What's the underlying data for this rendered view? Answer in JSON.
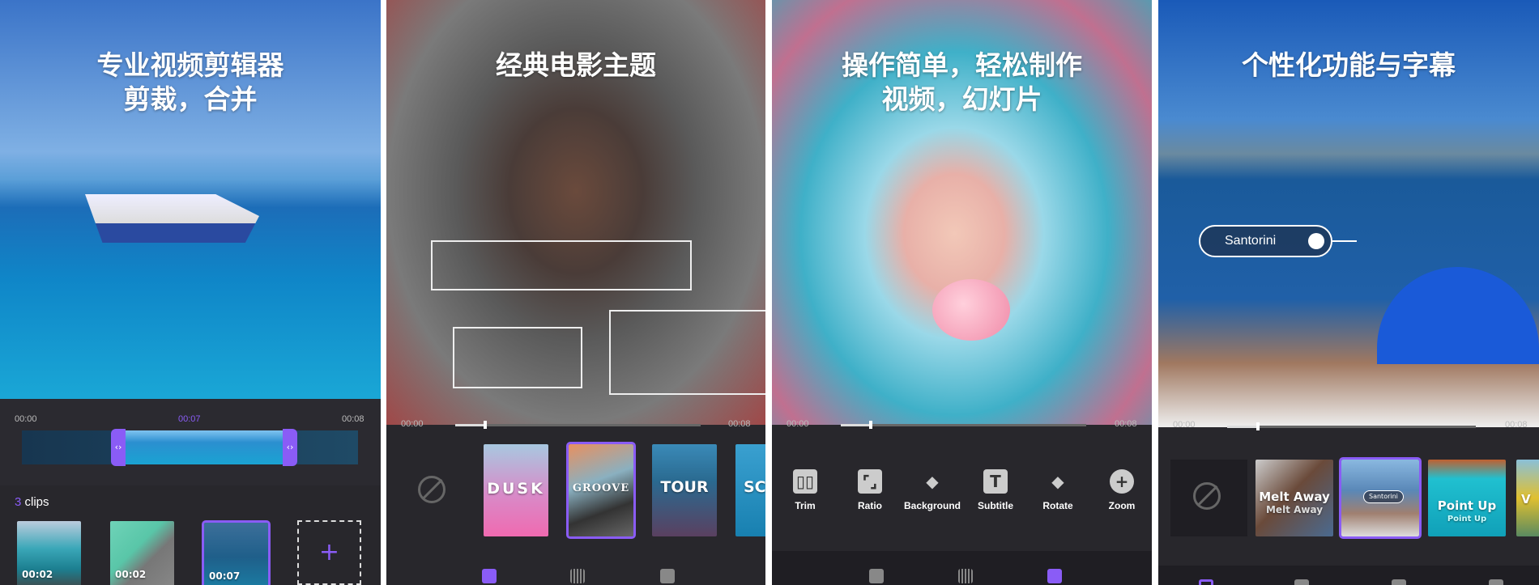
{
  "colors": {
    "accent": "#8a5cf6",
    "panel_bg": "#28272c"
  },
  "panels": [
    {
      "headline": [
        "专业视频剪辑器",
        "剪裁，合并"
      ],
      "timeline": {
        "start": "00:00",
        "current": "00:07",
        "end": "00:08"
      },
      "clips_count": "3",
      "clips_label": "clips",
      "clips": [
        {
          "duration": "00:02"
        },
        {
          "duration": "00:02"
        },
        {
          "duration": "00:07",
          "selected": true
        }
      ],
      "add_icon": "plus-icon"
    },
    {
      "headline": [
        "经典电影主题"
      ],
      "timeline": {
        "start": "00:00",
        "end": "00:08",
        "progress": 0.12
      },
      "themes": [
        {
          "label": "DUSK"
        },
        {
          "label": "GROOVE",
          "selected": true
        },
        {
          "label": "TOUR"
        },
        {
          "label": "SCE"
        }
      ],
      "nav_icons": [
        "theme-icon",
        "music-icon",
        "adjust-icon"
      ],
      "active_nav": 0
    },
    {
      "headline": [
        "操作简单，轻松制作",
        "视频，幻灯片"
      ],
      "timeline": {
        "start": "00:00",
        "end": "00:08",
        "progress": 0.12
      },
      "tools": [
        {
          "label": "Trim",
          "icon": "trim-icon"
        },
        {
          "label": "Ratio",
          "icon": "ratio-icon"
        },
        {
          "label": "Background",
          "icon": "paint-bucket-icon"
        },
        {
          "label": "Subtitle",
          "icon": "text-icon"
        },
        {
          "label": "Rotate",
          "icon": "rotate-icon"
        },
        {
          "label": "Zoom",
          "icon": "zoom-in-icon"
        }
      ],
      "nav_icons": [
        "theme-icon",
        "music-icon",
        "adjust-icon"
      ],
      "active_nav": 2
    },
    {
      "headline": [
        "个性化功能与字幕"
      ],
      "location_tag": "Santorini",
      "timeline": {
        "start": "00:00",
        "end": "00:08",
        "progress": 0.12
      },
      "styles": [
        {
          "title": "Melt Away",
          "sub": "Melt Away"
        },
        {
          "title": "Santorini",
          "selected": true
        },
        {
          "title": "Point Up",
          "sub": "Point Up"
        },
        {
          "title": "V"
        }
      ]
    }
  ]
}
